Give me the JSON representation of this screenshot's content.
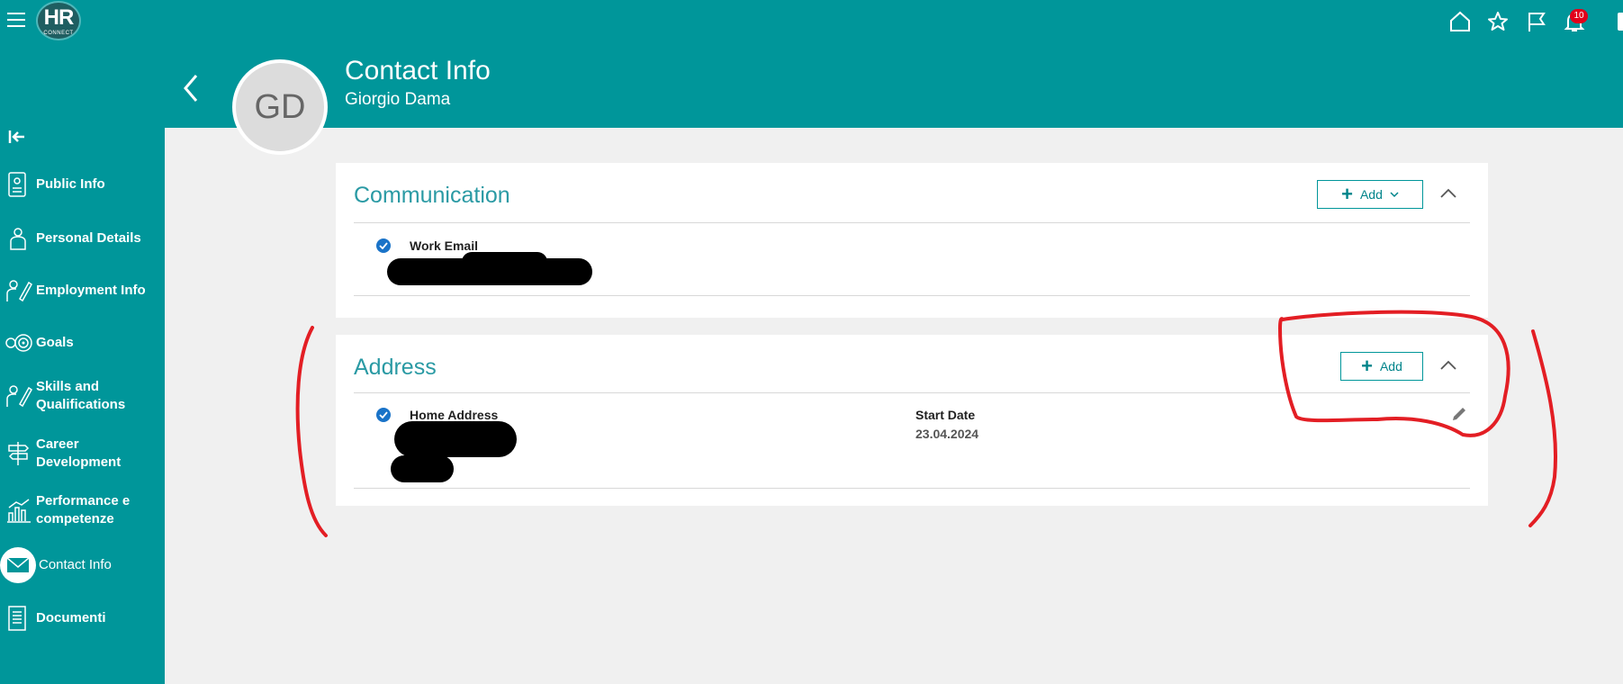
{
  "app": {
    "logo_text": "HR",
    "logo_subtext": "CONNECT",
    "notification_count": "10",
    "top_icons": [
      "home-icon",
      "star-icon",
      "flag-icon",
      "bell-icon"
    ]
  },
  "sidebar": {
    "items": [
      {
        "label": "Public Info",
        "icon": "id-card-icon"
      },
      {
        "label": "Personal Details",
        "icon": "person-icon"
      },
      {
        "label": "Employment Info",
        "icon": "employment-icon"
      },
      {
        "label": "Goals",
        "icon": "target-icon"
      },
      {
        "label": "Skills and Qualifications",
        "icon": "skills-icon"
      },
      {
        "label": "Career Development",
        "icon": "signpost-icon"
      },
      {
        "label": "Performance e competenze",
        "icon": "chart-bars-icon"
      },
      {
        "label": "Contact Info",
        "icon": "envelope-icon",
        "active": true
      },
      {
        "label": "Documenti",
        "icon": "document-icon"
      }
    ]
  },
  "header": {
    "avatar_initials": "GD",
    "title": "Contact Info",
    "subtitle": "Giorgio Dama"
  },
  "communication": {
    "title": "Communication",
    "add_label": "Add",
    "field_label": "Work Email"
  },
  "address": {
    "title": "Address",
    "add_label": "Add",
    "field_label": "Home Address",
    "start_date_label": "Start Date",
    "start_date_value": "23.04.2024"
  },
  "colors": {
    "brand_teal": "#00969a",
    "title_teal": "#2a9aa4",
    "check_blue": "#1a73c8",
    "badge_red": "#e2001a",
    "annotation_red": "#e31e24"
  }
}
